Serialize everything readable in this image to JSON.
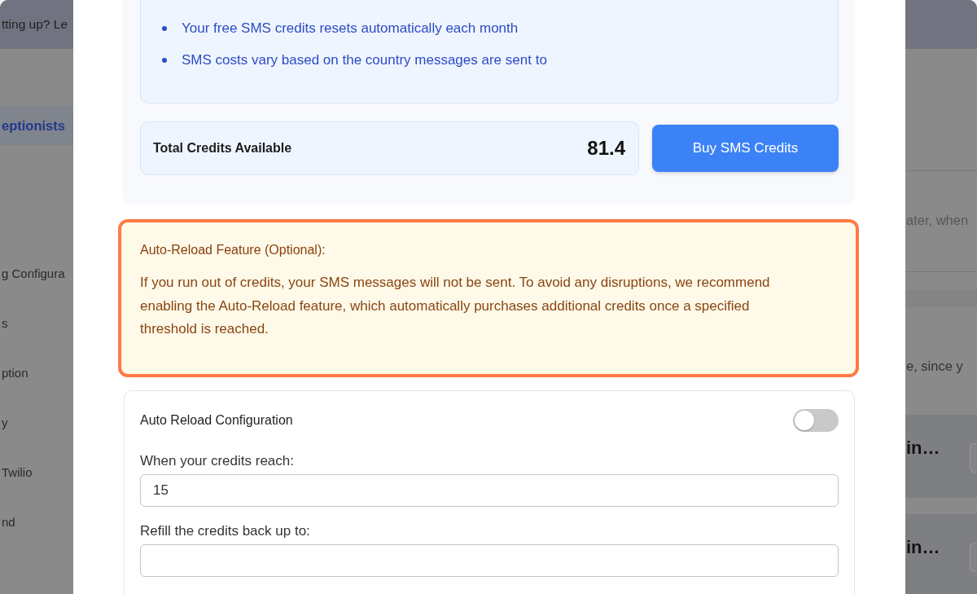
{
  "background_page": {
    "banner": {
      "text": "tting up? Le"
    },
    "sidebar": {
      "items": [
        {
          "label": "eptionists",
          "selected": true
        },
        {
          "label": "g Configura",
          "selected": false
        },
        {
          "label": "s",
          "selected": false
        },
        {
          "label": "ption",
          "selected": false
        },
        {
          "label": "y",
          "selected": false
        },
        {
          "label": "Twilio",
          "selected": false
        },
        {
          "label": "nd",
          "selected": false
        }
      ]
    },
    "right_panel": {
      "lines": [
        "ater, when",
        "e, since y"
      ],
      "cards": [
        {
          "title": "in…"
        },
        {
          "title": "in…"
        }
      ]
    }
  },
  "modal": {
    "info_list": {
      "items": [
        "Your free SMS credits resets automatically each month",
        "SMS costs vary based on the country messages are sent to"
      ]
    },
    "credits": {
      "label": "Total Credits Available",
      "value": "81.4"
    },
    "buy_button": {
      "label": "Buy SMS Credits"
    },
    "alert": {
      "title": "Auto-Reload Feature (Optional):",
      "body": "If you run out of credits, your SMS messages will not be sent. To avoid any disruptions, we recommend enabling the Auto-Reload feature, which automatically purchases additional credits once a specified threshold is reached.",
      "highlighted": true
    },
    "auto_reload": {
      "title": "Auto Reload Configuration",
      "on": false,
      "fields": [
        {
          "label": "When your credits reach:",
          "value": "15"
        },
        {
          "label": "Refill the credits back up to:"
        }
      ]
    }
  }
}
